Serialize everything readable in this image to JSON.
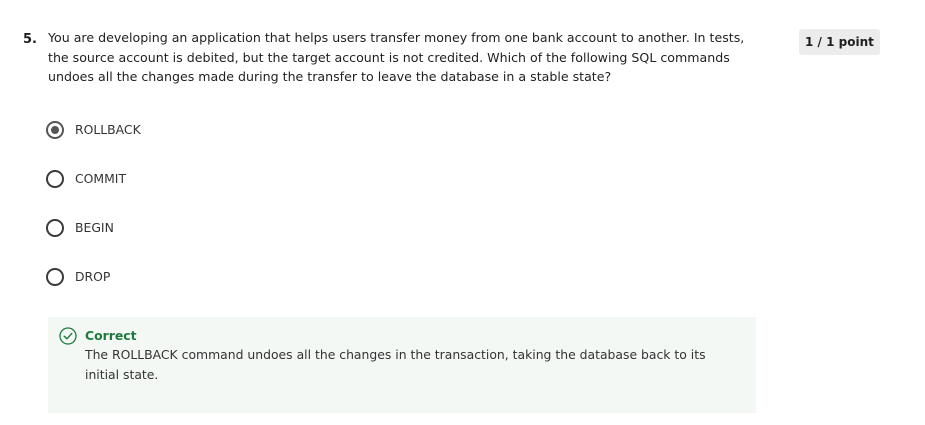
{
  "question": {
    "number": "5.",
    "text": "You are developing an application that helps users transfer money from one bank account to another. In tests, the source account is debited, but the target account is not credited. Which of the following SQL commands undoes all the changes made during the transfer to leave the database in a stable state?",
    "score": "1 / 1 point"
  },
  "options": [
    {
      "label": "ROLLBACK",
      "selected": true
    },
    {
      "label": "COMMIT",
      "selected": false
    },
    {
      "label": "BEGIN",
      "selected": false
    },
    {
      "label": "DROP",
      "selected": false
    }
  ],
  "feedback": {
    "status": "Correct",
    "message": "The ROLLBACK command undoes all the changes in the transaction, taking the database back to its initial state.",
    "status_color": "#1e7a3c",
    "icon": "check-circle-icon"
  }
}
